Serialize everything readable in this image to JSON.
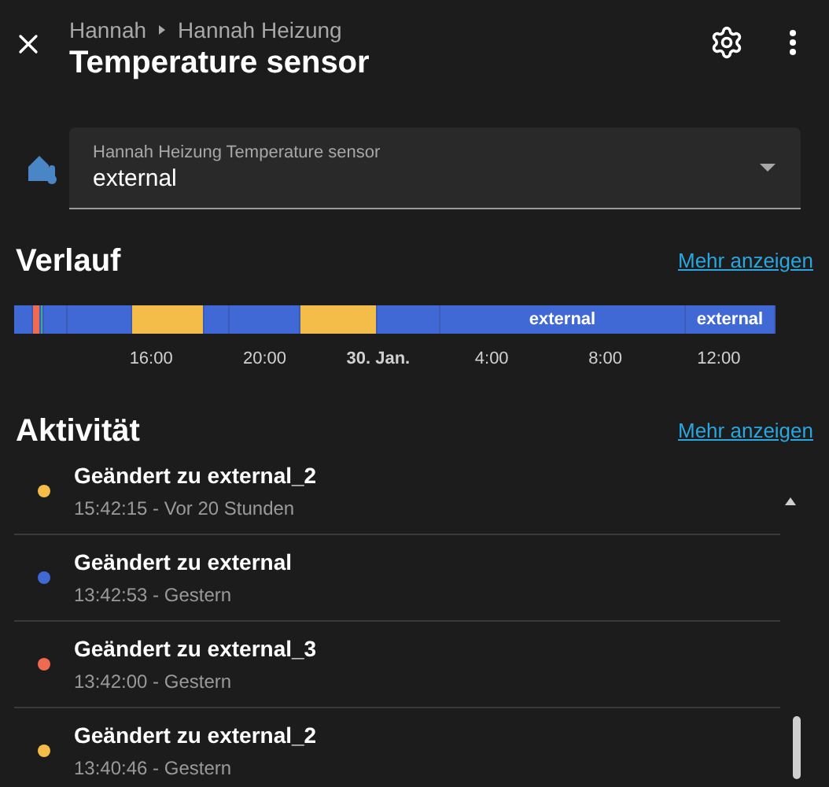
{
  "header": {
    "breadcrumb": [
      "Hannah",
      "Hannah Heizung"
    ],
    "title": "Temperature sensor"
  },
  "select": {
    "label": "Hannah Heizung Temperature sensor",
    "value": "external"
  },
  "history": {
    "title": "Verlauf",
    "link": "Mehr anzeigen",
    "segments": [
      {
        "color": "#4169d6"
      },
      {
        "color": "#ee6a50"
      },
      {
        "color": "#3fa79a"
      },
      {
        "color": "#4169d6"
      },
      {
        "color": "#4169d6"
      },
      {
        "color": "#f4bd4a"
      },
      {
        "color": "#4169d6"
      },
      {
        "color": "#4169d6"
      },
      {
        "color": "#f4bd4a"
      },
      {
        "color": "#4169d6"
      },
      {
        "color": "#4169d6",
        "label": "external"
      },
      {
        "color": "#4169d6",
        "label": "external"
      }
    ],
    "ticks": [
      {
        "label": "16:00",
        "bold": false
      },
      {
        "label": "20:00",
        "bold": false
      },
      {
        "label": "30. Jan.",
        "bold": true
      },
      {
        "label": "4:00",
        "bold": false
      },
      {
        "label": "8:00",
        "bold": false
      },
      {
        "label": "12:00",
        "bold": false
      }
    ]
  },
  "activity": {
    "title": "Aktivität",
    "link": "Mehr anzeigen",
    "items": [
      {
        "text": "Geändert zu external_2",
        "time": "15:42:15 - Vor 20 Stunden",
        "color": "#f4bd4a"
      },
      {
        "text": "Geändert zu external",
        "time": "13:42:53 - Gestern",
        "color": "#4169d6"
      },
      {
        "text": "Geändert zu external_3",
        "time": "13:42:00 - Gestern",
        "color": "#ee6a50"
      },
      {
        "text": "Geändert zu external_2",
        "time": "13:40:46 - Gestern",
        "color": "#f4bd4a"
      }
    ]
  }
}
